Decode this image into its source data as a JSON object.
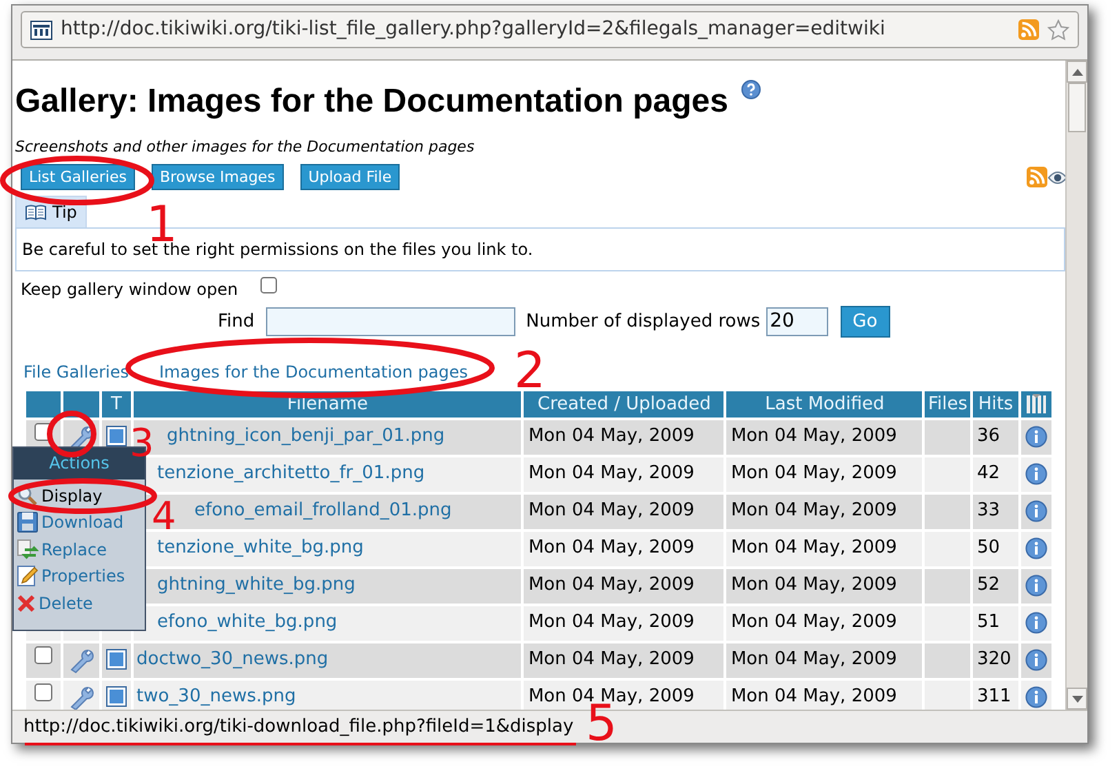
{
  "browser": {
    "url": "http://doc.tikiwiki.org/tiki-list_file_gallery.php?galleryId=2&filegals_manager=editwiki"
  },
  "page": {
    "title": "Gallery: Images for the Documentation pages",
    "description": "Screenshots and other images for the Documentation pages",
    "buttons": [
      {
        "label": "List Galleries"
      },
      {
        "label": "Browse Images"
      },
      {
        "label": "Upload File"
      }
    ],
    "tip": {
      "tab": "Tip",
      "text": "Be careful to set the right permissions on the files you link to."
    },
    "keep_open": {
      "label": "Keep gallery window open",
      "checked": false
    },
    "find": {
      "label": "Find",
      "rows_label": "Number of displayed rows",
      "rows_value": "20",
      "button": "Go"
    },
    "breadcrumb": [
      "File Galleries",
      "Images for the Documentation pages"
    ],
    "table": {
      "columns": [
        "T",
        "Filename",
        "Created / Uploaded",
        "Last Modified",
        "Files",
        "Hits"
      ],
      "rows": [
        {
          "checked": false,
          "filename": "ghtning_icon_benji_par_01.png",
          "created": "Mon 04 May, 2009",
          "modified": "Mon 04 May, 2009",
          "hits": "36"
        },
        {
          "filename": "tenzione_architetto_fr_01.png",
          "created": "Mon 04 May, 2009",
          "modified": "Mon 04 May, 2009",
          "hits": "42"
        },
        {
          "filename": "efono_email_frolland_01.png",
          "created": "Mon 04 May, 2009",
          "modified": "Mon 04 May, 2009",
          "hits": "33"
        },
        {
          "filename": "tenzione_white_bg.png",
          "created": "Mon 04 May, 2009",
          "modified": "Mon 04 May, 2009",
          "hits": "50"
        },
        {
          "filename": "ghtning_white_bg.png",
          "created": "Mon 04 May, 2009",
          "modified": "Mon 04 May, 2009",
          "hits": "52"
        },
        {
          "filename": "efono_white_bg.png",
          "created": "Mon 04 May, 2009",
          "modified": "Mon 04 May, 2009",
          "hits": "51"
        },
        {
          "checked": false,
          "filename": "doctwo_30_news.png",
          "created": "Mon 04 May, 2009",
          "modified": "Mon 04 May, 2009",
          "hits": "320"
        },
        {
          "checked": false,
          "filename": "two_30_news.png",
          "created": "Mon 04 May, 2009",
          "modified": "Mon 04 May, 2009",
          "hits": "311"
        }
      ]
    },
    "actions_menu": {
      "title": "Actions",
      "items": [
        {
          "label": "Display",
          "kind": "display",
          "hovered": true
        },
        {
          "label": "Download",
          "kind": "download",
          "hovered": false
        },
        {
          "label": "Replace",
          "kind": "replace",
          "hovered": false
        },
        {
          "label": "Properties",
          "kind": "properties",
          "hovered": false
        },
        {
          "label": "Delete",
          "kind": "delete",
          "hovered": false
        }
      ]
    }
  },
  "status_bar": {
    "text": "http://doc.tikiwiki.org/tiki-download_file.php?fileId=1&display"
  },
  "annotations": [
    {
      "label": "1",
      "kind": "ellipse"
    },
    {
      "label": "2",
      "kind": "ellipse"
    },
    {
      "label": "3",
      "kind": "ellipse"
    },
    {
      "label": "4",
      "kind": "ellipse"
    },
    {
      "label": "5",
      "kind": "underline"
    }
  ]
}
